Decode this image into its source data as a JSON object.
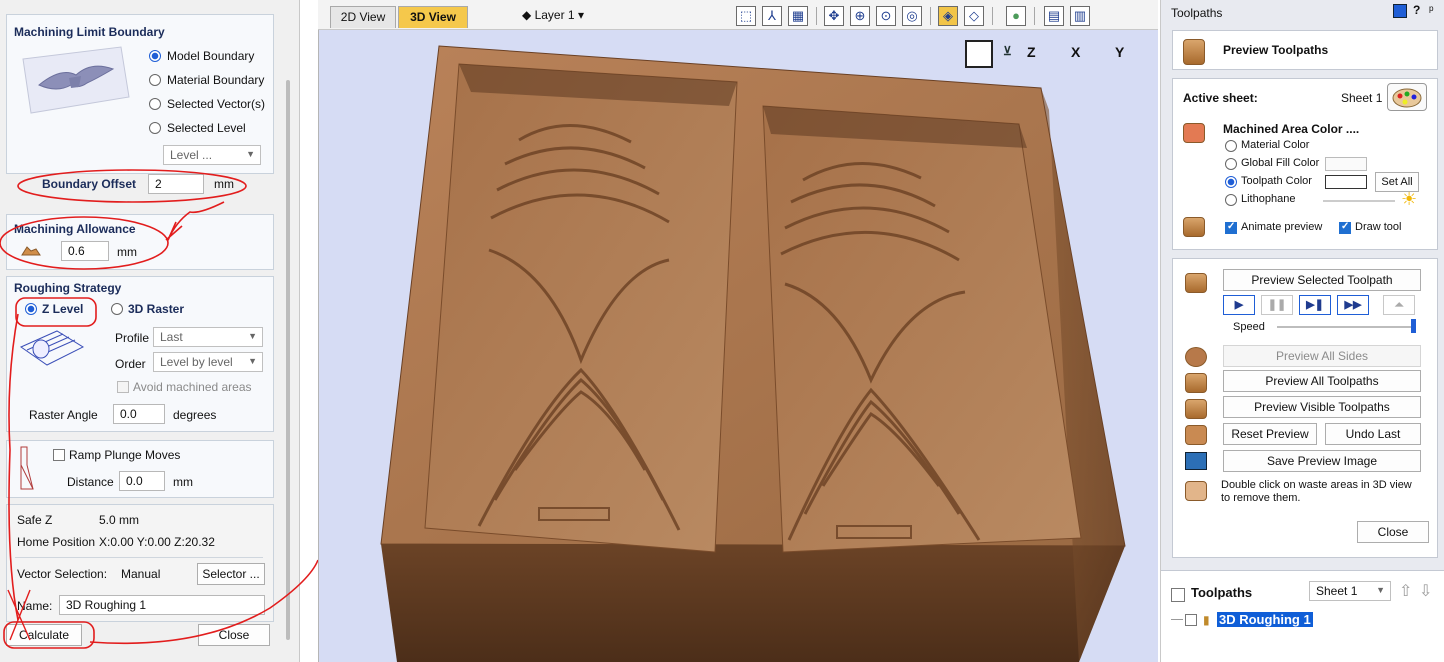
{
  "left_panel": {
    "boundary_title": "Machining Limit Boundary",
    "boundary_options": [
      "Model Boundary",
      "Material Boundary",
      "Selected Vector(s)",
      "Selected Level"
    ],
    "boundary_level_placeholder": "Level ...",
    "boundary_offset_label": "Boundary Offset",
    "boundary_offset_value": "2",
    "boundary_offset_unit": "mm",
    "allowance_title": "Machining Allowance",
    "allowance_value": "0.6",
    "allowance_unit": "mm",
    "roughing_title": "Roughing Strategy",
    "z_level_label": "Z Level",
    "raster_label": "3D Raster",
    "profile_label": "Profile",
    "profile_value": "Last",
    "order_label": "Order",
    "order_value": "Level by level",
    "avoid_label": "Avoid machined areas",
    "raster_angle_label": "Raster Angle",
    "raster_angle_value": "0.0",
    "raster_angle_unit": "degrees",
    "ramp_label": "Ramp Plunge Moves",
    "distance_label": "Distance",
    "distance_value": "0.0",
    "distance_unit": "mm",
    "safe_z_label": "Safe Z",
    "safe_z_value": "5.0 mm",
    "home_label": "Home Position",
    "home_value": "X:0.00 Y:0.00 Z:20.32",
    "vector_sel_label": "Vector Selection:",
    "vector_sel_value": "Manual",
    "selector_button": "Selector ...",
    "name_label": "Name:",
    "name_value": "3D Roughing 1",
    "calculate_button": "Calculate",
    "close_button": "Close"
  },
  "view": {
    "tab_2d": "2D View",
    "tab_3d": "3D View",
    "layer_label": "Layer 1",
    "axis_labels": [
      "Z",
      "X",
      "Y"
    ]
  },
  "right_panel": {
    "header_title": "Toolpaths",
    "preview_title": "Preview Toolpaths",
    "active_sheet_label": "Active sheet:",
    "active_sheet_value": "Sheet 1",
    "machined_color_label": "Machined Area Color ....",
    "color_options": [
      "Material Color",
      "Global Fill Color",
      "Toolpath Color",
      "Lithophane"
    ],
    "set_all_button": "Set All",
    "animate_label": "Animate preview",
    "draw_tool_label": "Draw tool",
    "preview_selected_button": "Preview Selected Toolpath",
    "speed_label": "Speed",
    "preview_all_sides_button": "Preview All Sides",
    "preview_all_toolpaths_button": "Preview All Toolpaths",
    "preview_visible_button": "Preview Visible Toolpaths",
    "reset_preview_button": "Reset Preview",
    "undo_last_button": "Undo Last",
    "save_image_button": "Save Preview Image",
    "hint_text_1": "Double click on waste areas in 3D view",
    "hint_text_2": "to remove them.",
    "close_button": "Close",
    "toolpaths_list_title": "Toolpaths",
    "sheet_select_value": "Sheet 1",
    "toolpath_item": "3D Roughing 1"
  },
  "colors": {
    "accent": "#1f5ed6",
    "annotation_red": "#e21d1d",
    "wood": "#a8744a",
    "view_background": "#d6dcf4"
  }
}
